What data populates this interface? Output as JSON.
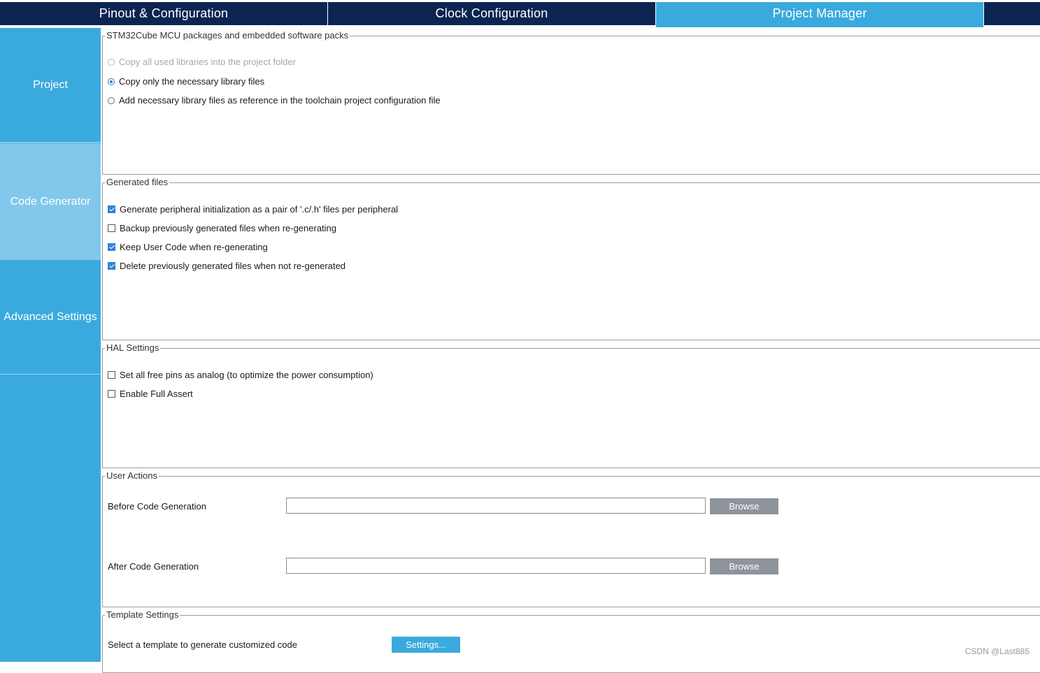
{
  "tabs": [
    {
      "label": "Pinout & Configuration",
      "active": false
    },
    {
      "label": "Clock Configuration",
      "active": false
    },
    {
      "label": "Project Manager",
      "active": true
    }
  ],
  "sidebar": {
    "items": [
      {
        "label": "Project",
        "active": false
      },
      {
        "label": "Code Generator",
        "active": true
      },
      {
        "label": "Advanced Settings",
        "active": false
      }
    ]
  },
  "packs": {
    "title": "STM32Cube MCU packages and embedded software packs",
    "options": [
      {
        "label": "Copy all used libraries into the project folder",
        "selected": false,
        "disabled": true
      },
      {
        "label": "Copy only the necessary library files",
        "selected": true,
        "disabled": false
      },
      {
        "label": "Add necessary library files as reference in the toolchain project configuration file",
        "selected": false,
        "disabled": false
      }
    ]
  },
  "generated_files": {
    "title": "Generated files",
    "options": [
      {
        "label": "Generate peripheral initialization as a pair of '.c/.h' files per peripheral",
        "checked": true
      },
      {
        "label": "Backup previously generated files when re-generating",
        "checked": false
      },
      {
        "label": "Keep User Code when re-generating",
        "checked": true
      },
      {
        "label": "Delete previously generated files when not re-generated",
        "checked": true
      }
    ]
  },
  "hal_settings": {
    "title": "HAL Settings",
    "options": [
      {
        "label": "Set all free pins as analog (to optimize the power consumption)",
        "checked": false
      },
      {
        "label": "Enable Full Assert",
        "checked": false
      }
    ]
  },
  "user_actions": {
    "title": "User Actions",
    "before_label": "Before Code Generation",
    "before_value": "",
    "after_label": "After Code Generation",
    "after_value": "",
    "browse_label": "Browse"
  },
  "template_settings": {
    "title": "Template Settings",
    "label": "Select a template to generate customized code",
    "button_label": "Settings..."
  },
  "watermark": "CSDN @Last885",
  "colors": {
    "navy": "#0b2452",
    "accent_blue": "#3aaade",
    "sidebar_active": "#82c8ec",
    "button_gray": "#8e949b"
  }
}
